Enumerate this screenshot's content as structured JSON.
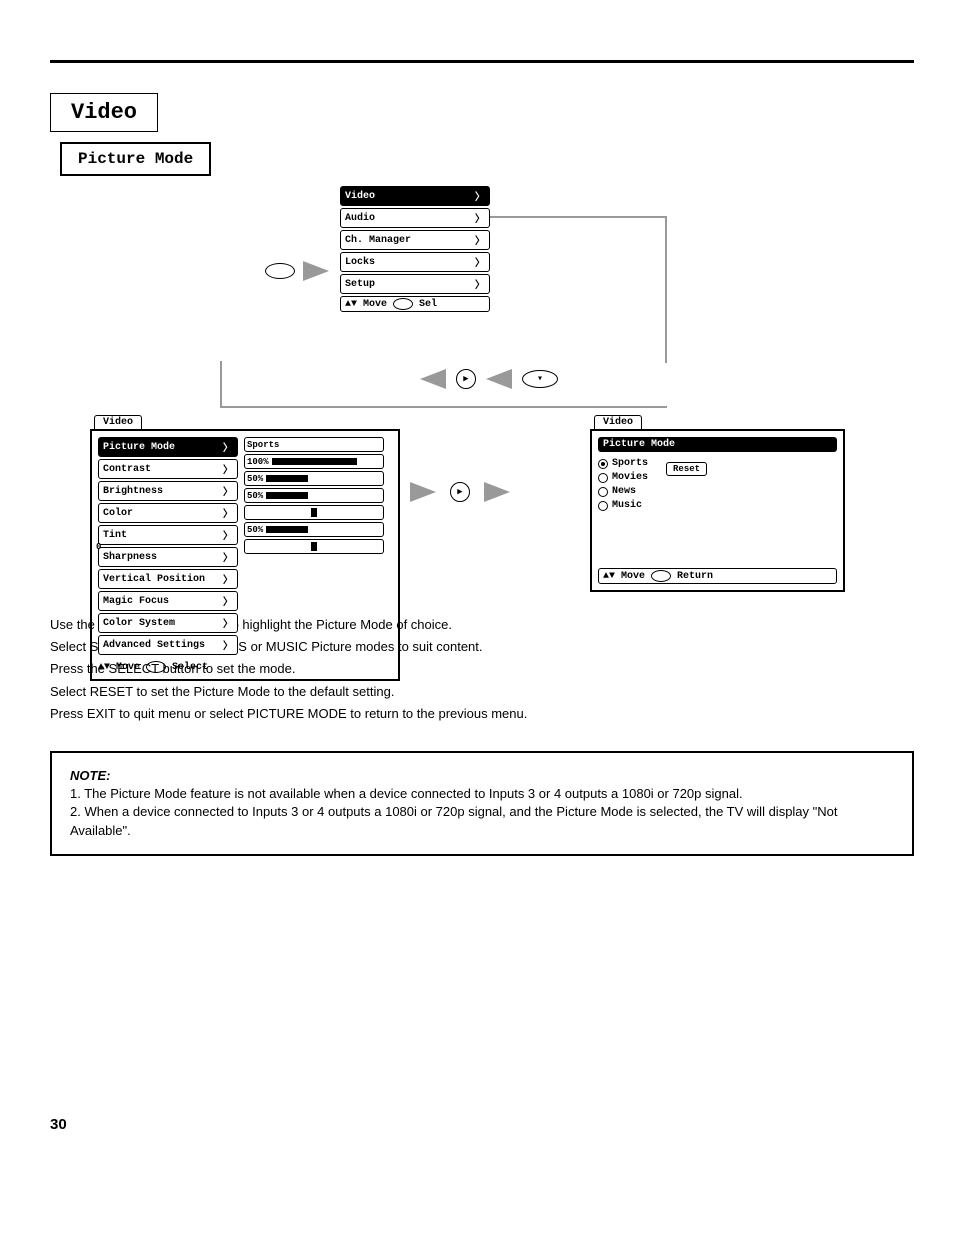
{
  "header": {
    "title": "Video",
    "subtitle": "Picture Mode"
  },
  "main_menu": {
    "items": [
      "Video",
      "Audio",
      "Ch. Manager",
      "Locks",
      "Setup"
    ],
    "hint_move": "Move",
    "hint_sel": "Sel"
  },
  "video_menu": {
    "tab": "Video",
    "rows": [
      {
        "label": "Picture Mode"
      },
      {
        "label": "Contrast"
      },
      {
        "label": "Brightness"
      },
      {
        "label": "Color"
      },
      {
        "label": "Tint"
      },
      {
        "label": "Sharpness"
      },
      {
        "label": "Vertical Position"
      },
      {
        "label": "Magic Focus"
      },
      {
        "label": "Color System"
      },
      {
        "label": "Advanced Settings"
      }
    ],
    "values": [
      {
        "label": "Sports"
      },
      {
        "label": "100%",
        "fill": 100
      },
      {
        "label": "50%",
        "fill": 50
      },
      {
        "label": "50%",
        "fill": 50
      },
      {
        "label": "",
        "center": true
      },
      {
        "label": "50%",
        "fill": 50
      },
      {
        "label": "0",
        "center": true
      }
    ],
    "hint_move": "Move",
    "hint_sel": "Select"
  },
  "pm_menu": {
    "tab": "Video",
    "title": "Picture Mode",
    "options": [
      "Sports",
      "Movies",
      "News",
      "Music"
    ],
    "selected": 0,
    "reset": "Reset",
    "hint_move": "Move",
    "hint_ret": "Return"
  },
  "body": {
    "p1_a": "Use the CURSOR PAD ",
    "p1_b": " to highlight the Picture Mode of choice.",
    "p2": "Select SPORTS, MOVIES, NEWS or MUSIC Picture modes to suit content.",
    "p3": "Press the SELECT button to set the mode.",
    "p4": "Select RESET to set the Picture Mode to the default setting.",
    "p5": "Press EXIT to quit menu or select PICTURE MODE to return to the previous menu."
  },
  "note": {
    "title": "NOTE:",
    "l1": "1. The Picture Mode feature is not available when a device connected to Inputs 3 or 4 outputs a 1080i or 720p signal.",
    "l2": "2. When a device connected to Inputs 3 or 4 outputs a 1080i or 720p signal, and the Picture Mode is selected, the TV will display \"Not Available\"."
  },
  "page": "30"
}
